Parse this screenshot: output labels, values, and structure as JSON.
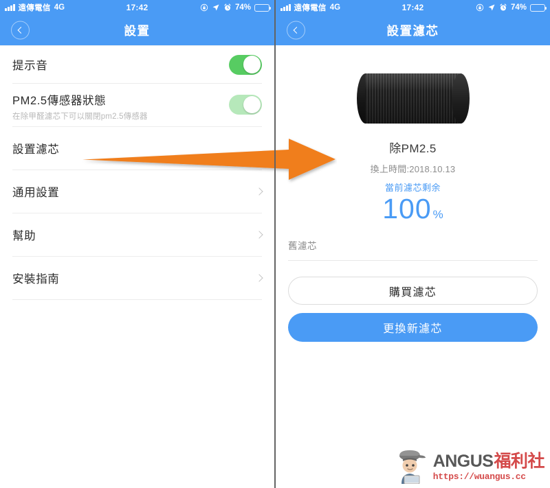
{
  "status_bar": {
    "carrier": "遠傳電信",
    "network": "4G",
    "time": "17:42",
    "battery_pct": "74%",
    "battery_level": 74,
    "icons": [
      "signal-bars-icon",
      "rotation-lock-icon",
      "location-arrow-icon",
      "alarm-clock-icon",
      "battery-icon"
    ]
  },
  "left_screen": {
    "nav": {
      "title": "設置",
      "back_icon": "chevron-left-icon"
    },
    "rows": [
      {
        "label": "提示音",
        "sub": "",
        "control": "toggle",
        "toggle_state": "on"
      },
      {
        "label": "PM2.5傳感器狀態",
        "sub": "在除甲醛濾芯下可以關閉pm2.5傳感器",
        "control": "toggle",
        "toggle_state": "faded"
      },
      {
        "label": "設置濾芯",
        "sub": "",
        "control": "none"
      },
      {
        "label": "通用設置",
        "sub": "",
        "control": "chevron"
      },
      {
        "label": "幫助",
        "sub": "",
        "control": "chevron"
      },
      {
        "label": "安裝指南",
        "sub": "",
        "control": "chevron"
      }
    ]
  },
  "right_screen": {
    "nav": {
      "title": "設置濾芯",
      "back_icon": "chevron-left-icon"
    },
    "filter": {
      "image_alt": "filter-cartridge-image",
      "name": "除PM2.5",
      "install_date": "換上時間:2018.10.13",
      "remaining_label": "當前濾芯剩余",
      "remaining_value": "100",
      "remaining_unit": "%"
    },
    "old_filter_label": "舊濾芯",
    "buttons": {
      "buy": "購買濾芯",
      "replace": "更換新濾芯"
    }
  },
  "annotation": {
    "arrow_color": "#F07E1E",
    "arrow_name": "orange-pointer-arrow"
  },
  "watermark": {
    "brand_latin": "ANGUS",
    "brand_cn": "福利社",
    "url": "https://wuangus.cc"
  },
  "colors": {
    "accent_blue": "#4a9bf5",
    "toggle_green": "#57cc62",
    "toggle_green_faded": "#b6e8ba",
    "divider_gray": "#ececec",
    "panel_divider": "#636363"
  }
}
